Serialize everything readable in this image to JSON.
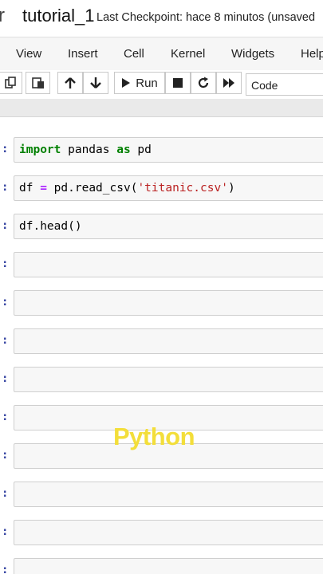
{
  "header": {
    "logo_fragment": "r",
    "notebook_title": "tutorial_1",
    "checkpoint_text": "Last Checkpoint: hace 8 minutos  (unsaved"
  },
  "menu": {
    "items": [
      "View",
      "Insert",
      "Cell",
      "Kernel",
      "Widgets",
      "Help"
    ]
  },
  "toolbar": {
    "buttons": [
      "copy-icon",
      "paste-icon",
      "move-up-icon",
      "move-down-icon",
      "run-icon",
      "stop-icon",
      "restart-icon",
      "fast-forward-icon"
    ],
    "run_label": "Run",
    "cell_type": "Code"
  },
  "cells": [
    {
      "prompt": ":",
      "tokens": [
        {
          "t": "import",
          "c": "kw"
        },
        {
          "t": " pandas ",
          "c": ""
        },
        {
          "t": "as",
          "c": "kw"
        },
        {
          "t": " pd",
          "c": ""
        }
      ]
    },
    {
      "prompt": ":",
      "tokens": [
        {
          "t": "df ",
          "c": ""
        },
        {
          "t": "=",
          "c": "op"
        },
        {
          "t": " pd.read_csv(",
          "c": ""
        },
        {
          "t": "'titanic.csv'",
          "c": "str"
        },
        {
          "t": ")",
          "c": ""
        }
      ]
    },
    {
      "prompt": ":",
      "tokens": [
        {
          "t": "df.head()",
          "c": ""
        }
      ]
    },
    {
      "prompt": ":",
      "tokens": []
    },
    {
      "prompt": ":",
      "tokens": []
    },
    {
      "prompt": ":",
      "tokens": []
    },
    {
      "prompt": ":",
      "tokens": []
    },
    {
      "prompt": ":",
      "tokens": []
    },
    {
      "prompt": ":",
      "tokens": []
    },
    {
      "prompt": ":",
      "tokens": []
    },
    {
      "prompt": ":",
      "tokens": []
    },
    {
      "prompt": ":",
      "tokens": []
    }
  ],
  "overlay": {
    "watermark_text": "Python",
    "watermark_color": "#f3de3a"
  },
  "colors": {
    "keyword": "#008000",
    "operator": "#aa22ff",
    "string": "#ba2121",
    "cell_bg": "#f7f7f7"
  }
}
